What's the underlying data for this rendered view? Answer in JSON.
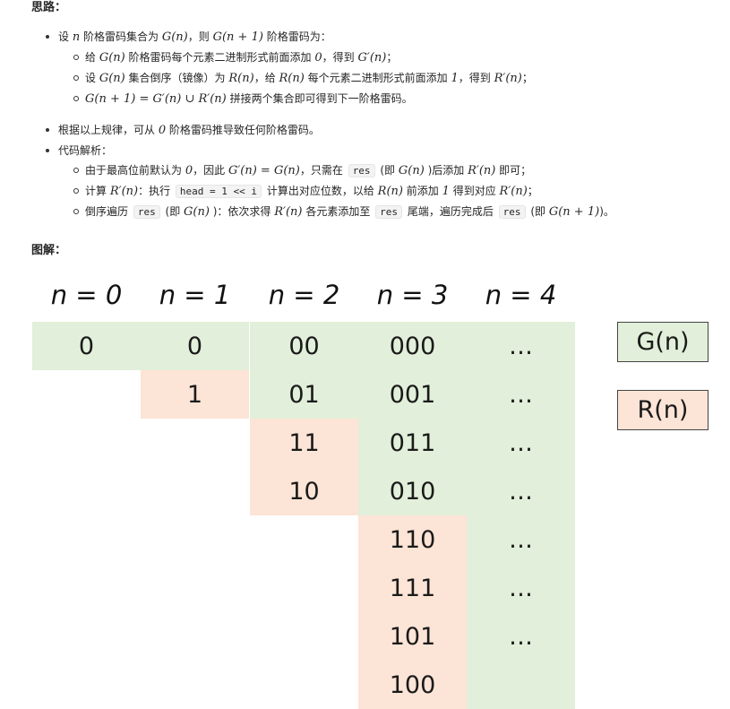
{
  "heading_think": "思路：",
  "heading_diagram": "图解：",
  "list_a": {
    "item1": {
      "pre": "设 ",
      "m1": "n",
      "mid": " 阶格雷码集合为 ",
      "m2": "G(n)",
      "mid2": "，则 ",
      "m3": "G(n + 1)",
      "post": " 阶格雷码为："
    },
    "sub1": {
      "pre": "给 ",
      "m1": "G(n)",
      "mid": " 阶格雷码每个元素二进制形式前面添加 ",
      "m2": "0",
      "mid2": "，得到 ",
      "m3": "G′(n)",
      "post": "；"
    },
    "sub2": {
      "pre": "设 ",
      "m1": "G(n)",
      "mid": " 集合倒序（镜像）为 ",
      "m2": "R(n)",
      "mid2": "，给 ",
      "m3": "R(n)",
      "mid3": " 每个元素二进制形式前面添加 ",
      "m4": "1",
      "mid4": "，得到 ",
      "m5": "R′(n)",
      "post": "；"
    },
    "sub3": {
      "m1": "G(n + 1) = G′(n) ∪ R′(n)",
      "post": " 拼接两个集合即可得到下一阶格雷码。"
    }
  },
  "list_b": {
    "item1": {
      "pre": "根据以上规律，可从 ",
      "m1": "0",
      "post": " 阶格雷码推导致任何阶格雷码。"
    },
    "item2": {
      "text": "代码解析："
    },
    "sub1": {
      "pre": "由于最高位前默认为 ",
      "m1": "0",
      "mid": "，因此 ",
      "m2": "G′(n) = G(n)",
      "mid2": "，只需在 ",
      "c1": "res",
      "mid3": " (即 ",
      "m3": "G(n)",
      "mid4": " )后添加 ",
      "m4": "R′(n)",
      "post": " 即可；"
    },
    "sub2": {
      "pre": "计算 ",
      "m1": "R′(n)",
      "mid": "：执行 ",
      "c1": "head = 1 << i",
      "mid2": " 计算出对应位数，以给 ",
      "m2": "R(n)",
      "mid3": " 前添加 ",
      "m3": "1",
      "mid4": " 得到对应 ",
      "m4": "R′(n)",
      "post": "；"
    },
    "sub3": {
      "pre": "倒序遍历 ",
      "c1": "res",
      "mid": " (即 ",
      "m1": "G(n)",
      "mid2": " )：依次求得 ",
      "m2": "R′(n)",
      "mid3": " 各元素添加至 ",
      "c2": "res",
      "mid4": " 尾端，遍历完成后 ",
      "c3": "res",
      "mid5": " (即 ",
      "m3": "G(n + 1)",
      "post": ")。"
    }
  },
  "diagram": {
    "labels": [
      "n = 0",
      "n = 1",
      "n = 2",
      "n = 3",
      "n = 4"
    ],
    "col0": [
      "0"
    ],
    "col1": [
      "0",
      "1"
    ],
    "col2": [
      "00",
      "01",
      "11",
      "10"
    ],
    "col3": [
      "000",
      "001",
      "011",
      "010",
      "110",
      "111",
      "101",
      "100"
    ],
    "col4": [
      "…",
      "…",
      "…",
      "…",
      "…",
      "…",
      "…"
    ],
    "legend_g": "G(n)",
    "legend_r": "R(n)"
  },
  "colors": {
    "green": "#e2efda",
    "peach": "#fce4d6"
  }
}
